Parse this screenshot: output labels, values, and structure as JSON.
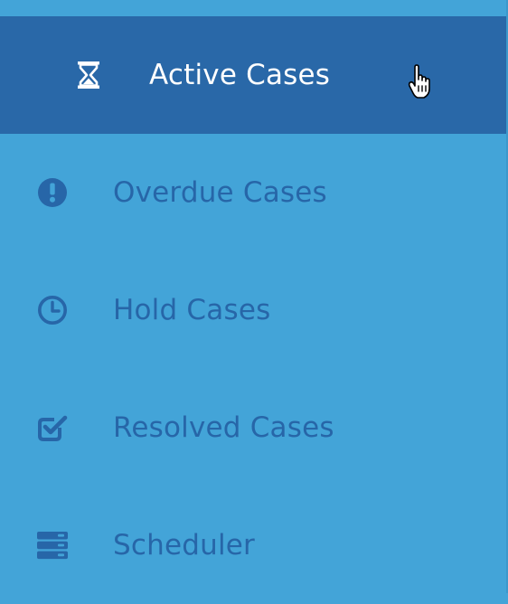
{
  "colors": {
    "background": "#43a4d8",
    "active_background": "#2968a8",
    "active_text": "#ffffff",
    "item_text": "#2766a8"
  },
  "nav": {
    "items": [
      {
        "label": "Active Cases",
        "icon": "hourglass-icon",
        "active": true
      },
      {
        "label": "Overdue Cases",
        "icon": "exclamation-circle-icon",
        "active": false
      },
      {
        "label": "Hold Cases",
        "icon": "clock-icon",
        "active": false
      },
      {
        "label": "Resolved Cases",
        "icon": "check-square-icon",
        "active": false
      },
      {
        "label": "Scheduler",
        "icon": "server-stack-icon",
        "active": false
      }
    ]
  }
}
